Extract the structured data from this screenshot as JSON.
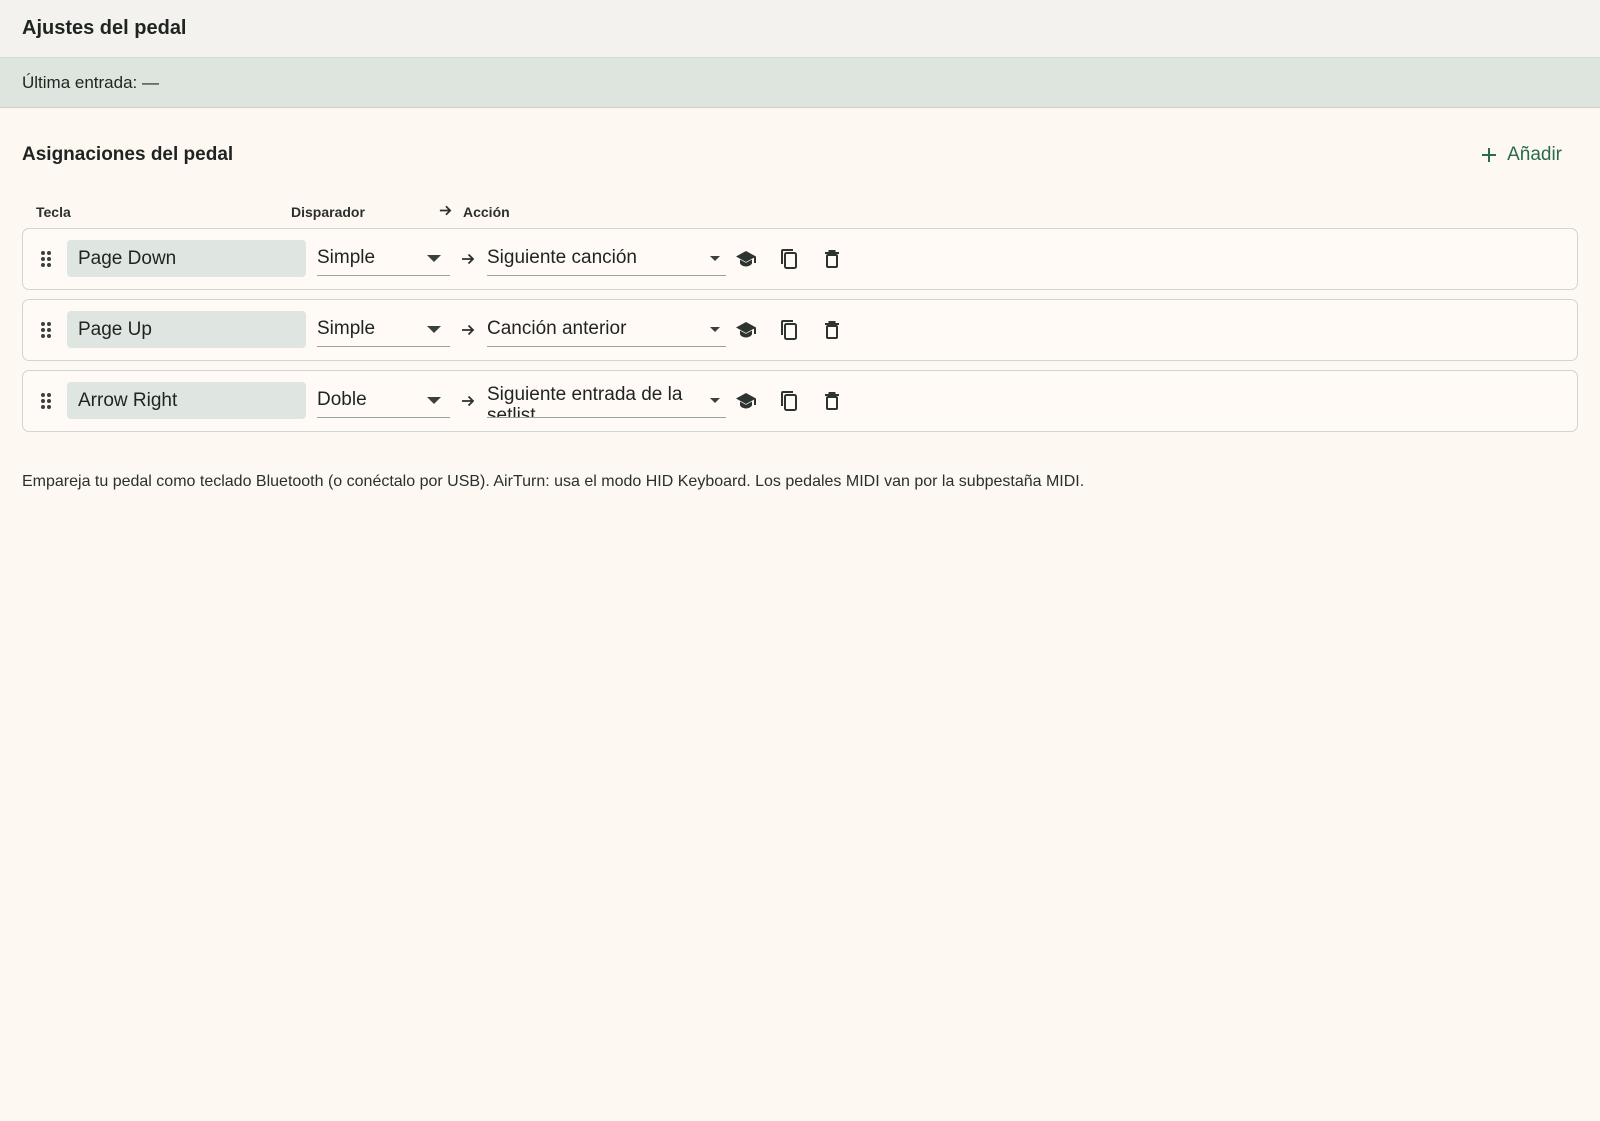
{
  "header": {
    "title": "Ajustes del pedal"
  },
  "status": {
    "last_input": "Última entrada: —"
  },
  "mappings": {
    "title": "Asignaciones del pedal",
    "add_label": "Añadir",
    "columns": {
      "key": "Tecla",
      "trigger": "Disparador",
      "action": "Acción"
    },
    "rows": [
      {
        "key": "Page Down",
        "trigger": "Simple",
        "action": "Siguiente canción"
      },
      {
        "key": "Page Up",
        "trigger": "Simple",
        "action": "Canción anterior"
      },
      {
        "key": "Arrow Right",
        "trigger": "Doble",
        "action": "Siguiente entrada de la setlist"
      }
    ]
  },
  "note": "Empareja tu pedal como teclado Bluetooth (o conéctalo por USB). AirTurn: usa el modo HID Keyboard. Los pedales MIDI van por la subpestaña MIDI.",
  "colors": {
    "accent": "#2a6b4d",
    "background": "#fef8f2",
    "status_bar": "#dee5df"
  },
  "icons": {
    "drag": "drag-handle-icon",
    "learn": "school-icon",
    "copy": "copy-icon",
    "delete": "trash-icon",
    "arrow": "arrow-right-icon",
    "add": "plus-icon"
  }
}
